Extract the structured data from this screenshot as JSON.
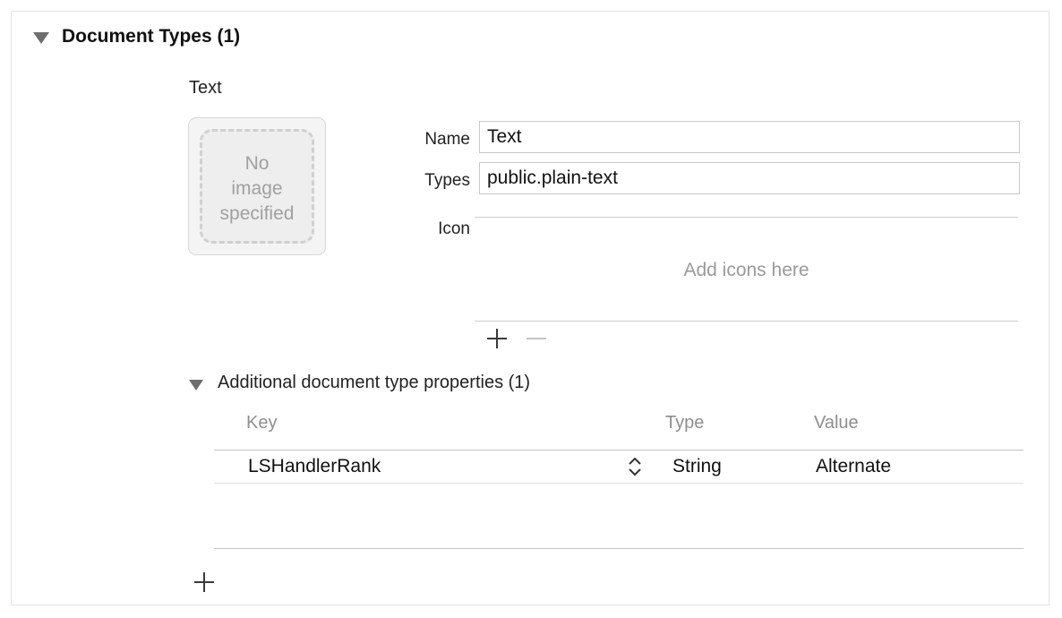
{
  "section": {
    "title": "Document Types (1)"
  },
  "document_type": {
    "title": "Text",
    "image_well": {
      "placeholder": "No image specified",
      "line1": "No",
      "line2": "image",
      "line3": "specified"
    },
    "fields": {
      "name_label": "Name",
      "name_value": "Text",
      "types_label": "Types",
      "types_value": "public.plain-text",
      "icon_label": "Icon"
    },
    "icons": {
      "placeholder": "Add icons here"
    }
  },
  "additional_properties": {
    "title": "Additional document type properties (1)",
    "columns": {
      "key": "Key",
      "type": "Type",
      "value": "Value"
    },
    "rows": [
      {
        "key": "LSHandlerRank",
        "type": "String",
        "value": "Alternate"
      }
    ]
  },
  "icons": {
    "section_disclosure": "disclosure-triangle-icon",
    "add": "plus-icon",
    "remove": "minus-icon",
    "stepper": "up-down-chevron-icon"
  },
  "colors": {
    "text": "#222222",
    "muted_text": "#9a9a9a",
    "divider": "#cfcfcf",
    "field_border": "#c9c9c9"
  }
}
